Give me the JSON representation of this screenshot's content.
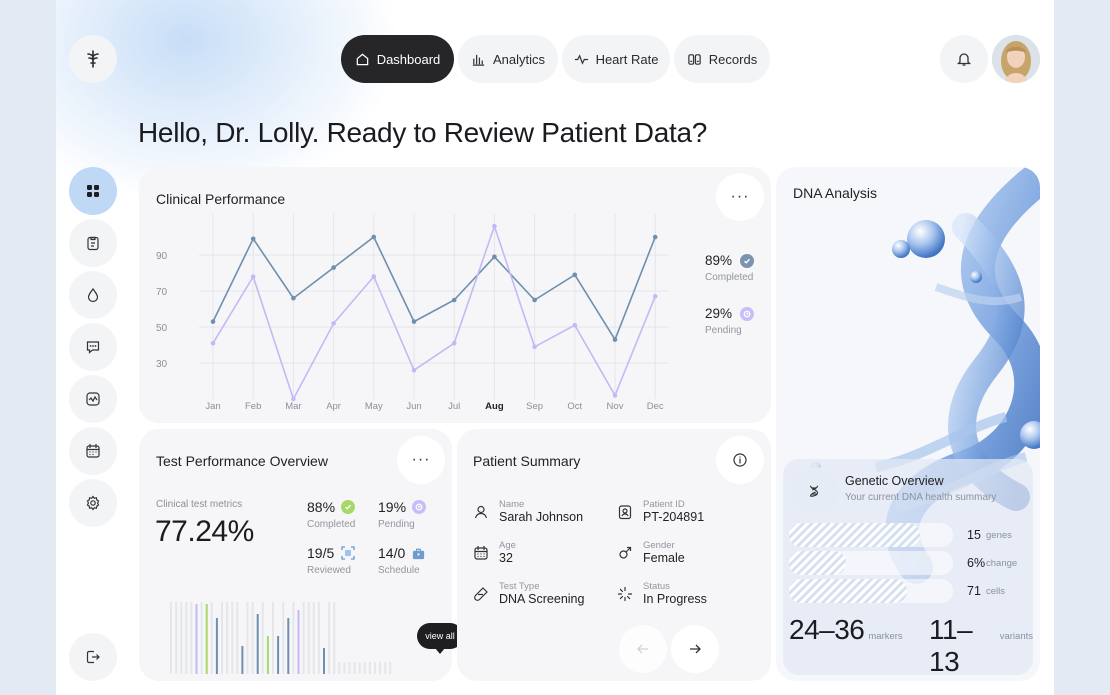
{
  "nav": {
    "items": [
      {
        "label": "Dashboard",
        "icon": "home-icon",
        "active": true
      },
      {
        "label": "Analytics",
        "icon": "bar-chart-icon",
        "active": false
      },
      {
        "label": "Heart Rate",
        "icon": "pulse-icon",
        "active": false
      },
      {
        "label": "Records",
        "icon": "records-icon",
        "active": false
      }
    ]
  },
  "greeting": "Hello, Dr. Lolly. Ready to Review Patient Data?",
  "sidebar": {
    "items": [
      "grid-icon",
      "clipboard-icon",
      "drop-icon",
      "chat-icon",
      "activity-icon",
      "calendar-icon",
      "settings-icon"
    ],
    "logout": "logout-icon"
  },
  "clinical": {
    "title": "Clinical Performance",
    "y_ticks": [
      "90",
      "70",
      "50",
      "30"
    ],
    "months": [
      "Jan",
      "Feb",
      "Mar",
      "Apr",
      "May",
      "Jun",
      "Jul",
      "Aug",
      "Sep",
      "Oct",
      "Nov",
      "Dec"
    ],
    "active_month": "Aug",
    "completed_value": "89%",
    "completed_label": "Completed",
    "pending_value": "29%",
    "pending_label": "Pending"
  },
  "chart_data": {
    "type": "line",
    "categories": [
      "Jan",
      "Feb",
      "Mar",
      "Apr",
      "May",
      "Jun",
      "Jul",
      "Aug",
      "Sep",
      "Oct",
      "Nov",
      "Dec"
    ],
    "series": [
      {
        "values": [
          53,
          99,
          66,
          83,
          100,
          53,
          65,
          89,
          65,
          79,
          43,
          100
        ],
        "color": "#6e8fae"
      },
      {
        "values": [
          41,
          78,
          10,
          52,
          78,
          26,
          41,
          106,
          39,
          51,
          12,
          67
        ],
        "color": "#c5b8f5"
      }
    ],
    "ylim": [
      10,
      110
    ],
    "grid": true
  },
  "test": {
    "title": "Test Performance Overview",
    "metric_label": "Clinical test metrics",
    "metric_value": "77.24%",
    "stats": [
      {
        "value": "88%",
        "label": "Completed"
      },
      {
        "value": "19%",
        "label": "Pending"
      },
      {
        "value": "19/5",
        "label": "Reviewed"
      },
      {
        "value": "14/0",
        "label": "Schedule"
      }
    ],
    "view_all": "view all"
  },
  "patient": {
    "title": "Patient Summary",
    "fields": [
      {
        "label": "Name",
        "value": "Sarah Johnson"
      },
      {
        "label": "Patient ID",
        "value": "PT-204891"
      },
      {
        "label": "Age",
        "value": "32"
      },
      {
        "label": "Gender",
        "value": "Female"
      },
      {
        "label": "Test Type",
        "value": "DNA Screening"
      },
      {
        "label": "Status",
        "value": "In Progress"
      }
    ]
  },
  "dna": {
    "title": "DNA Analysis",
    "overview_title": "Genetic Overview",
    "overview_sub": "Your current DNA health summary",
    "rows": [
      {
        "value": "15",
        "unit": "genes",
        "fill": 0.8
      },
      {
        "value": "6%",
        "unit": "change",
        "fill": 0.35
      },
      {
        "value": "71",
        "unit": "cells",
        "fill": 0.72
      }
    ],
    "markers_value": "24–36",
    "markers_unit": "markers",
    "variants_value": "11–13",
    "variants_unit": "variants"
  },
  "colors": {
    "accent": "#bed8f5",
    "dark": "#262628",
    "line1": "#6e8fae",
    "line2": "#c5b8f5",
    "green": "#a6d96a",
    "lavender": "#c5b8f5"
  }
}
